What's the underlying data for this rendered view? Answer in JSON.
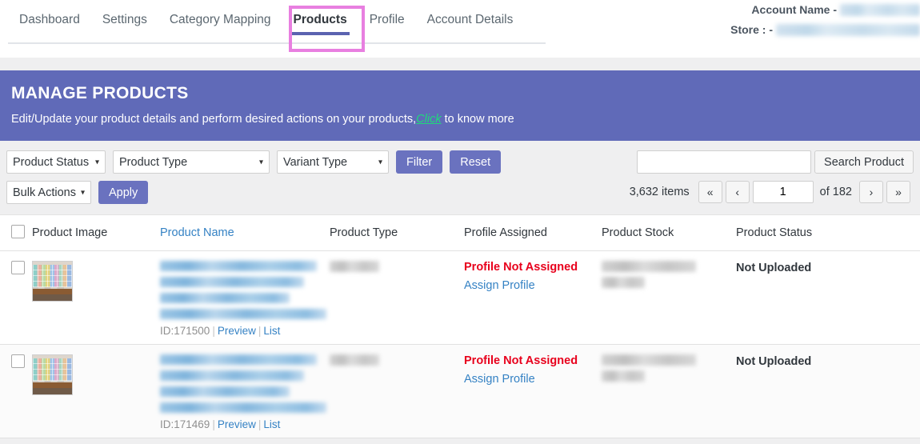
{
  "nav": {
    "items": [
      {
        "label": "Dashboard",
        "active": false
      },
      {
        "label": "Settings",
        "active": false
      },
      {
        "label": "Category Mapping",
        "active": false
      },
      {
        "label": "Products",
        "active": true
      },
      {
        "label": "Profile",
        "active": false
      },
      {
        "label": "Account Details",
        "active": false
      }
    ],
    "highlight_color": "#e87fe0",
    "active_underline_color": "#5b63b0"
  },
  "account": {
    "name_label": "Account Name -",
    "name_value": "",
    "store_label": "Store : -",
    "store_value": ""
  },
  "banner": {
    "title": "MANAGE PRODUCTS",
    "desc_before": "Edit/Update your product details and perform desired actions on your products,",
    "link": "Click",
    "desc_after": " to know more",
    "bg_color": "#606ab8",
    "link_color": "#1edb7a"
  },
  "toolbar": {
    "product_status": "Product Status",
    "product_type": "Product Type",
    "variant_type": "Variant Type",
    "filter_label": "Filter",
    "reset_label": "Reset",
    "bulk_actions": "Bulk Actions",
    "apply_label": "Apply",
    "caret": "▾",
    "button_color": "#6a72bf"
  },
  "search": {
    "value": "",
    "placeholder": "",
    "button_label": "Search Product"
  },
  "pagination": {
    "items_text": "3,632 items",
    "first": "«",
    "prev": "‹",
    "current_page": "1",
    "of_text": "of 182",
    "next": "›",
    "last": "»"
  },
  "table": {
    "headers": [
      {
        "label": "Product Image",
        "link": false
      },
      {
        "label": "Product Name",
        "link": true
      },
      {
        "label": "Product Type",
        "link": false
      },
      {
        "label": "Profile Assigned",
        "link": false
      },
      {
        "label": "Product Stock",
        "link": false
      },
      {
        "label": "Product Status",
        "link": false
      }
    ],
    "rows": [
      {
        "id_label": "ID:171500",
        "preview_label": "Preview",
        "list_label": "List",
        "separator": "|",
        "profile_status": "Profile Not Assigned",
        "assign_link": "Assign Profile",
        "product_status": "Not Uploaded"
      },
      {
        "id_label": "ID:171469",
        "preview_label": "Preview",
        "list_label": "List",
        "separator": "|",
        "profile_status": "Profile Not Assigned",
        "assign_link": "Assign Profile",
        "product_status": "Not Uploaded"
      }
    ]
  }
}
